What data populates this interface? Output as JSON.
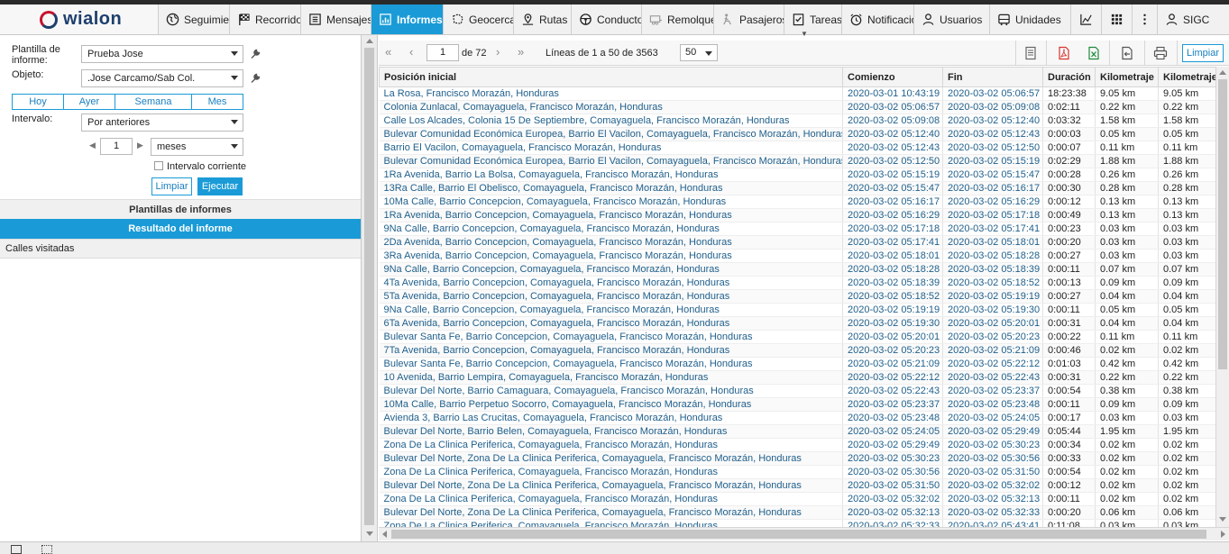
{
  "nav": {
    "logo_text": "wialon",
    "tabs": [
      {
        "label": "Seguimiento",
        "icon": "globe-icon"
      },
      {
        "label": "Recorridos",
        "icon": "checkered-flag-icon"
      },
      {
        "label": "Mensajes",
        "icon": "list-icon"
      },
      {
        "label": "Informes",
        "icon": "report-chart-icon",
        "active": true
      },
      {
        "label": "Geocercas",
        "icon": "geofence-icon"
      },
      {
        "label": "Rutas",
        "icon": "route-pin-icon"
      },
      {
        "label": "Conductores",
        "icon": "steering-wheel-icon"
      },
      {
        "label": "Remolques",
        "icon": "trailer-icon"
      },
      {
        "label": "Pasajeros",
        "icon": "passenger-icon"
      },
      {
        "label": "Tareas",
        "icon": "task-checklist-icon"
      },
      {
        "label": "Notificaciones",
        "icon": "alarm-clock-icon"
      },
      {
        "label": "Usuarios",
        "icon": "user-icon"
      },
      {
        "label": "Unidades",
        "icon": "bus-icon"
      }
    ],
    "extra_icons": [
      "stats-icon",
      "apps-grid-icon",
      "more-vertical-icon"
    ],
    "account_label": "SIGC"
  },
  "form": {
    "template_label": "Plantilla de informe:",
    "template_value": "Prueba Jose",
    "object_label": "Objeto:",
    "object_value": ".Jose Carcamo/Sab Col.",
    "period_tabs": [
      "Hoy",
      "Ayer",
      "Semana",
      "Mes"
    ],
    "interval_label": "Intervalo:",
    "interval_value": "Por anteriores",
    "count_value": "1",
    "unit_value": "meses",
    "current_interval_label": "Intervalo corriente",
    "clear_label": "Limpiar",
    "run_label": "Ejecutar"
  },
  "sections": {
    "templates": "Plantillas de informes",
    "result": "Resultado del informe",
    "visited_streets": "Calles visitadas"
  },
  "toolbar": {
    "page_value": "1",
    "page_total": "de 72",
    "lines_text": "Líneas de 1 a 50 de 3563",
    "page_size": "50",
    "clear_label": "Limpiar"
  },
  "table": {
    "columns": [
      "Posición inicial",
      "Comienzo",
      "Fin",
      "Duración",
      "Kilometraje",
      "Kilometraje (ajustado)"
    ],
    "rows": [
      [
        "La Rosa, Francisco Morazán, Honduras",
        "2020-03-01 10:43:19",
        "2020-03-02 05:06:57",
        "18:23:38",
        "9.05 km",
        "9.05 km"
      ],
      [
        "Colonia Zunlacal, Comayaguela, Francisco Morazán, Honduras",
        "2020-03-02 05:06:57",
        "2020-03-02 05:09:08",
        "0:02:11",
        "0.22 km",
        "0.22 km"
      ],
      [
        "Calle Los Alcades, Colonia 15 De Septiembre, Comayaguela, Francisco Morazán, Honduras",
        "2020-03-02 05:09:08",
        "2020-03-02 05:12:40",
        "0:03:32",
        "1.58 km",
        "1.58 km"
      ],
      [
        "Bulevar Comunidad Económica Europea, Barrio El Vacilon, Comayaguela, Francisco Morazán, Honduras",
        "2020-03-02 05:12:40",
        "2020-03-02 05:12:43",
        "0:00:03",
        "0.05 km",
        "0.05 km"
      ],
      [
        "Barrio El Vacilon, Comayaguela, Francisco Morazán, Honduras",
        "2020-03-02 05:12:43",
        "2020-03-02 05:12:50",
        "0:00:07",
        "0.11 km",
        "0.11 km"
      ],
      [
        "Bulevar Comunidad Económica Europea, Barrio El Vacilon, Comayaguela, Francisco Morazán, Honduras",
        "2020-03-02 05:12:50",
        "2020-03-02 05:15:19",
        "0:02:29",
        "1.88 km",
        "1.88 km"
      ],
      [
        "1Ra Avenida, Barrio La Bolsa, Comayaguela, Francisco Morazán, Honduras",
        "2020-03-02 05:15:19",
        "2020-03-02 05:15:47",
        "0:00:28",
        "0.26 km",
        "0.26 km"
      ],
      [
        "13Ra Calle, Barrio El Obelisco, Comayaguela, Francisco Morazán, Honduras",
        "2020-03-02 05:15:47",
        "2020-03-02 05:16:17",
        "0:00:30",
        "0.28 km",
        "0.28 km"
      ],
      [
        "10Ma Calle, Barrio Concepcion, Comayaguela, Francisco Morazán, Honduras",
        "2020-03-02 05:16:17",
        "2020-03-02 05:16:29",
        "0:00:12",
        "0.13 km",
        "0.13 km"
      ],
      [
        "1Ra Avenida, Barrio Concepcion, Comayaguela, Francisco Morazán, Honduras",
        "2020-03-02 05:16:29",
        "2020-03-02 05:17:18",
        "0:00:49",
        "0.13 km",
        "0.13 km"
      ],
      [
        "9Na Calle, Barrio Concepcion, Comayaguela, Francisco Morazán, Honduras",
        "2020-03-02 05:17:18",
        "2020-03-02 05:17:41",
        "0:00:23",
        "0.03 km",
        "0.03 km"
      ],
      [
        "2Da Avenida, Barrio Concepcion, Comayaguela, Francisco Morazán, Honduras",
        "2020-03-02 05:17:41",
        "2020-03-02 05:18:01",
        "0:00:20",
        "0.03 km",
        "0.03 km"
      ],
      [
        "3Ra Avenida, Barrio Concepcion, Comayaguela, Francisco Morazán, Honduras",
        "2020-03-02 05:18:01",
        "2020-03-02 05:18:28",
        "0:00:27",
        "0.03 km",
        "0.03 km"
      ],
      [
        "9Na Calle, Barrio Concepcion, Comayaguela, Francisco Morazán, Honduras",
        "2020-03-02 05:18:28",
        "2020-03-02 05:18:39",
        "0:00:11",
        "0.07 km",
        "0.07 km"
      ],
      [
        "4Ta Avenida, Barrio Concepcion, Comayaguela, Francisco Morazán, Honduras",
        "2020-03-02 05:18:39",
        "2020-03-02 05:18:52",
        "0:00:13",
        "0.09 km",
        "0.09 km"
      ],
      [
        "5Ta Avenida, Barrio Concepcion, Comayaguela, Francisco Morazán, Honduras",
        "2020-03-02 05:18:52",
        "2020-03-02 05:19:19",
        "0:00:27",
        "0.04 km",
        "0.04 km"
      ],
      [
        "9Na Calle, Barrio Concepcion, Comayaguela, Francisco Morazán, Honduras",
        "2020-03-02 05:19:19",
        "2020-03-02 05:19:30",
        "0:00:11",
        "0.05 km",
        "0.05 km"
      ],
      [
        "6Ta Avenida, Barrio Concepcion, Comayaguela, Francisco Morazán, Honduras",
        "2020-03-02 05:19:30",
        "2020-03-02 05:20:01",
        "0:00:31",
        "0.04 km",
        "0.04 km"
      ],
      [
        "Bulevar Santa Fe, Barrio Concepcion, Comayaguela, Francisco Morazán, Honduras",
        "2020-03-02 05:20:01",
        "2020-03-02 05:20:23",
        "0:00:22",
        "0.11 km",
        "0.11 km"
      ],
      [
        "7Ta Avenida, Barrio Concepcion, Comayaguela, Francisco Morazán, Honduras",
        "2020-03-02 05:20:23",
        "2020-03-02 05:21:09",
        "0:00:46",
        "0.02 km",
        "0.02 km"
      ],
      [
        "Bulevar Santa Fe, Barrio Concepcion, Comayaguela, Francisco Morazán, Honduras",
        "2020-03-02 05:21:09",
        "2020-03-02 05:22:12",
        "0:01:03",
        "0.42 km",
        "0.42 km"
      ],
      [
        "10 Avenida, Barrio Lempira, Comayaguela, Francisco Morazán, Honduras",
        "2020-03-02 05:22:12",
        "2020-03-02 05:22:43",
        "0:00:31",
        "0.22 km",
        "0.22 km"
      ],
      [
        "Bulevar Del Norte, Barrio Camaguara, Comayaguela, Francisco Morazán, Honduras",
        "2020-03-02 05:22:43",
        "2020-03-02 05:23:37",
        "0:00:54",
        "0.38 km",
        "0.38 km"
      ],
      [
        "10Ma Calle, Barrio Perpetuo Socorro, Comayaguela, Francisco Morazán, Honduras",
        "2020-03-02 05:23:37",
        "2020-03-02 05:23:48",
        "0:00:11",
        "0.09 km",
        "0.09 km"
      ],
      [
        "Avienda 3, Barrio Las Crucitas, Comayaguela, Francisco Morazán, Honduras",
        "2020-03-02 05:23:48",
        "2020-03-02 05:24:05",
        "0:00:17",
        "0.03 km",
        "0.03 km"
      ],
      [
        "Bulevar Del Norte, Barrio Belen, Comayaguela, Francisco Morazán, Honduras",
        "2020-03-02 05:24:05",
        "2020-03-02 05:29:49",
        "0:05:44",
        "1.95 km",
        "1.95 km"
      ],
      [
        "Zona De La Clinica Periferica, Comayaguela, Francisco Morazán, Honduras",
        "2020-03-02 05:29:49",
        "2020-03-02 05:30:23",
        "0:00:34",
        "0.02 km",
        "0.02 km"
      ],
      [
        "Bulevar Del Norte, Zona De La Clinica Periferica, Comayaguela, Francisco Morazán, Honduras",
        "2020-03-02 05:30:23",
        "2020-03-02 05:30:56",
        "0:00:33",
        "0.02 km",
        "0.02 km"
      ],
      [
        "Zona De La Clinica Periferica, Comayaguela, Francisco Morazán, Honduras",
        "2020-03-02 05:30:56",
        "2020-03-02 05:31:50",
        "0:00:54",
        "0.02 km",
        "0.02 km"
      ],
      [
        "Bulevar Del Norte, Zona De La Clinica Periferica, Comayaguela, Francisco Morazán, Honduras",
        "2020-03-02 05:31:50",
        "2020-03-02 05:32:02",
        "0:00:12",
        "0.02 km",
        "0.02 km"
      ],
      [
        "Zona De La Clinica Periferica, Comayaguela, Francisco Morazán, Honduras",
        "2020-03-02 05:32:02",
        "2020-03-02 05:32:13",
        "0:00:11",
        "0.02 km",
        "0.02 km"
      ],
      [
        "Bulevar Del Norte, Zona De La Clinica Periferica, Comayaguela, Francisco Morazán, Honduras",
        "2020-03-02 05:32:13",
        "2020-03-02 05:32:33",
        "0:00:20",
        "0.06 km",
        "0.06 km"
      ],
      [
        "Zona De La Clinica Periferica, Comayaguela, Francisco Morazán, Honduras",
        "2020-03-02 05:32:33",
        "2020-03-02 05:43:41",
        "0:11:08",
        "0.03 km",
        "0.03 km"
      ]
    ]
  },
  "colors": {
    "accent": "#1a9bd7",
    "link": "#1f5f8b",
    "brand_red": "#c8102e",
    "brand_blue": "#1d3f6e"
  }
}
